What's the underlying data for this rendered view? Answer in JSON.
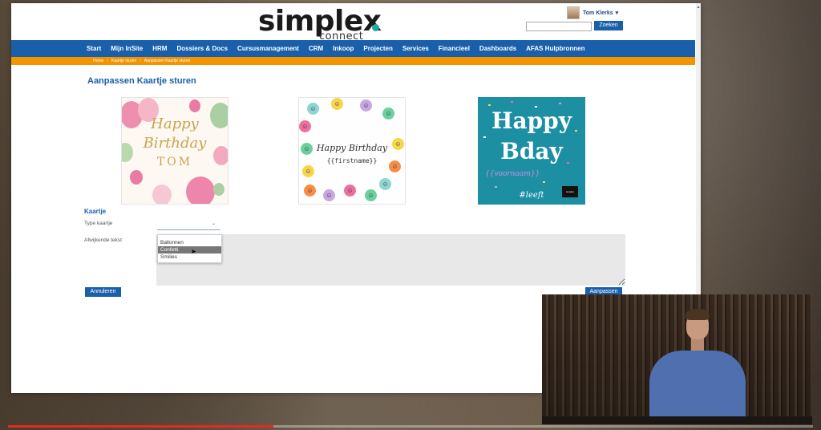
{
  "header": {
    "logo_main": "simplex",
    "logo_sub": "connect",
    "user_name": "Tom Klerks",
    "search_placeholder": "",
    "search_button": "Zoeken"
  },
  "nav": {
    "items": [
      "Start",
      "Mijn InSite",
      "HRM",
      "Dossiers & Docs",
      "Cursusmanagement",
      "CRM",
      "Inkoop",
      "Projecten",
      "Services",
      "Financieel",
      "Dashboards",
      "AFAS Hulpbronnen"
    ]
  },
  "breadcrumb": [
    "Home",
    "Kaartje sturen",
    "Aanpassen Kaartje sturen"
  ],
  "page": {
    "title": "Aanpassen Kaartje sturen"
  },
  "cards": [
    {
      "line1": "Happy",
      "line2": "Birthday",
      "line3": "TOM"
    },
    {
      "line1": "Happy Birthday",
      "line2": "{{firstname}}"
    },
    {
      "line1": "Happy",
      "line2": "Bday",
      "line3": "{{voornaam}}",
      "line4": "#leeft",
      "brand": "simplex"
    }
  ],
  "form": {
    "section_label": "Kaartje",
    "type_label": "Type kaartje",
    "type_value": "",
    "options": [
      "Ballonnen",
      "Confetti",
      "Smilies"
    ],
    "selected_option": "Confetti",
    "text_label": "Afwijkende tekst",
    "cancel_label": "Annuleren",
    "submit_label": "Aanpassen"
  },
  "video": {
    "progress_fraction": 0.33
  },
  "colors": {
    "brand_blue": "#1a5faa",
    "accent_orange": "#f29400",
    "logo_teal": "#1fa9a0",
    "progress_red": "#e52a20"
  }
}
